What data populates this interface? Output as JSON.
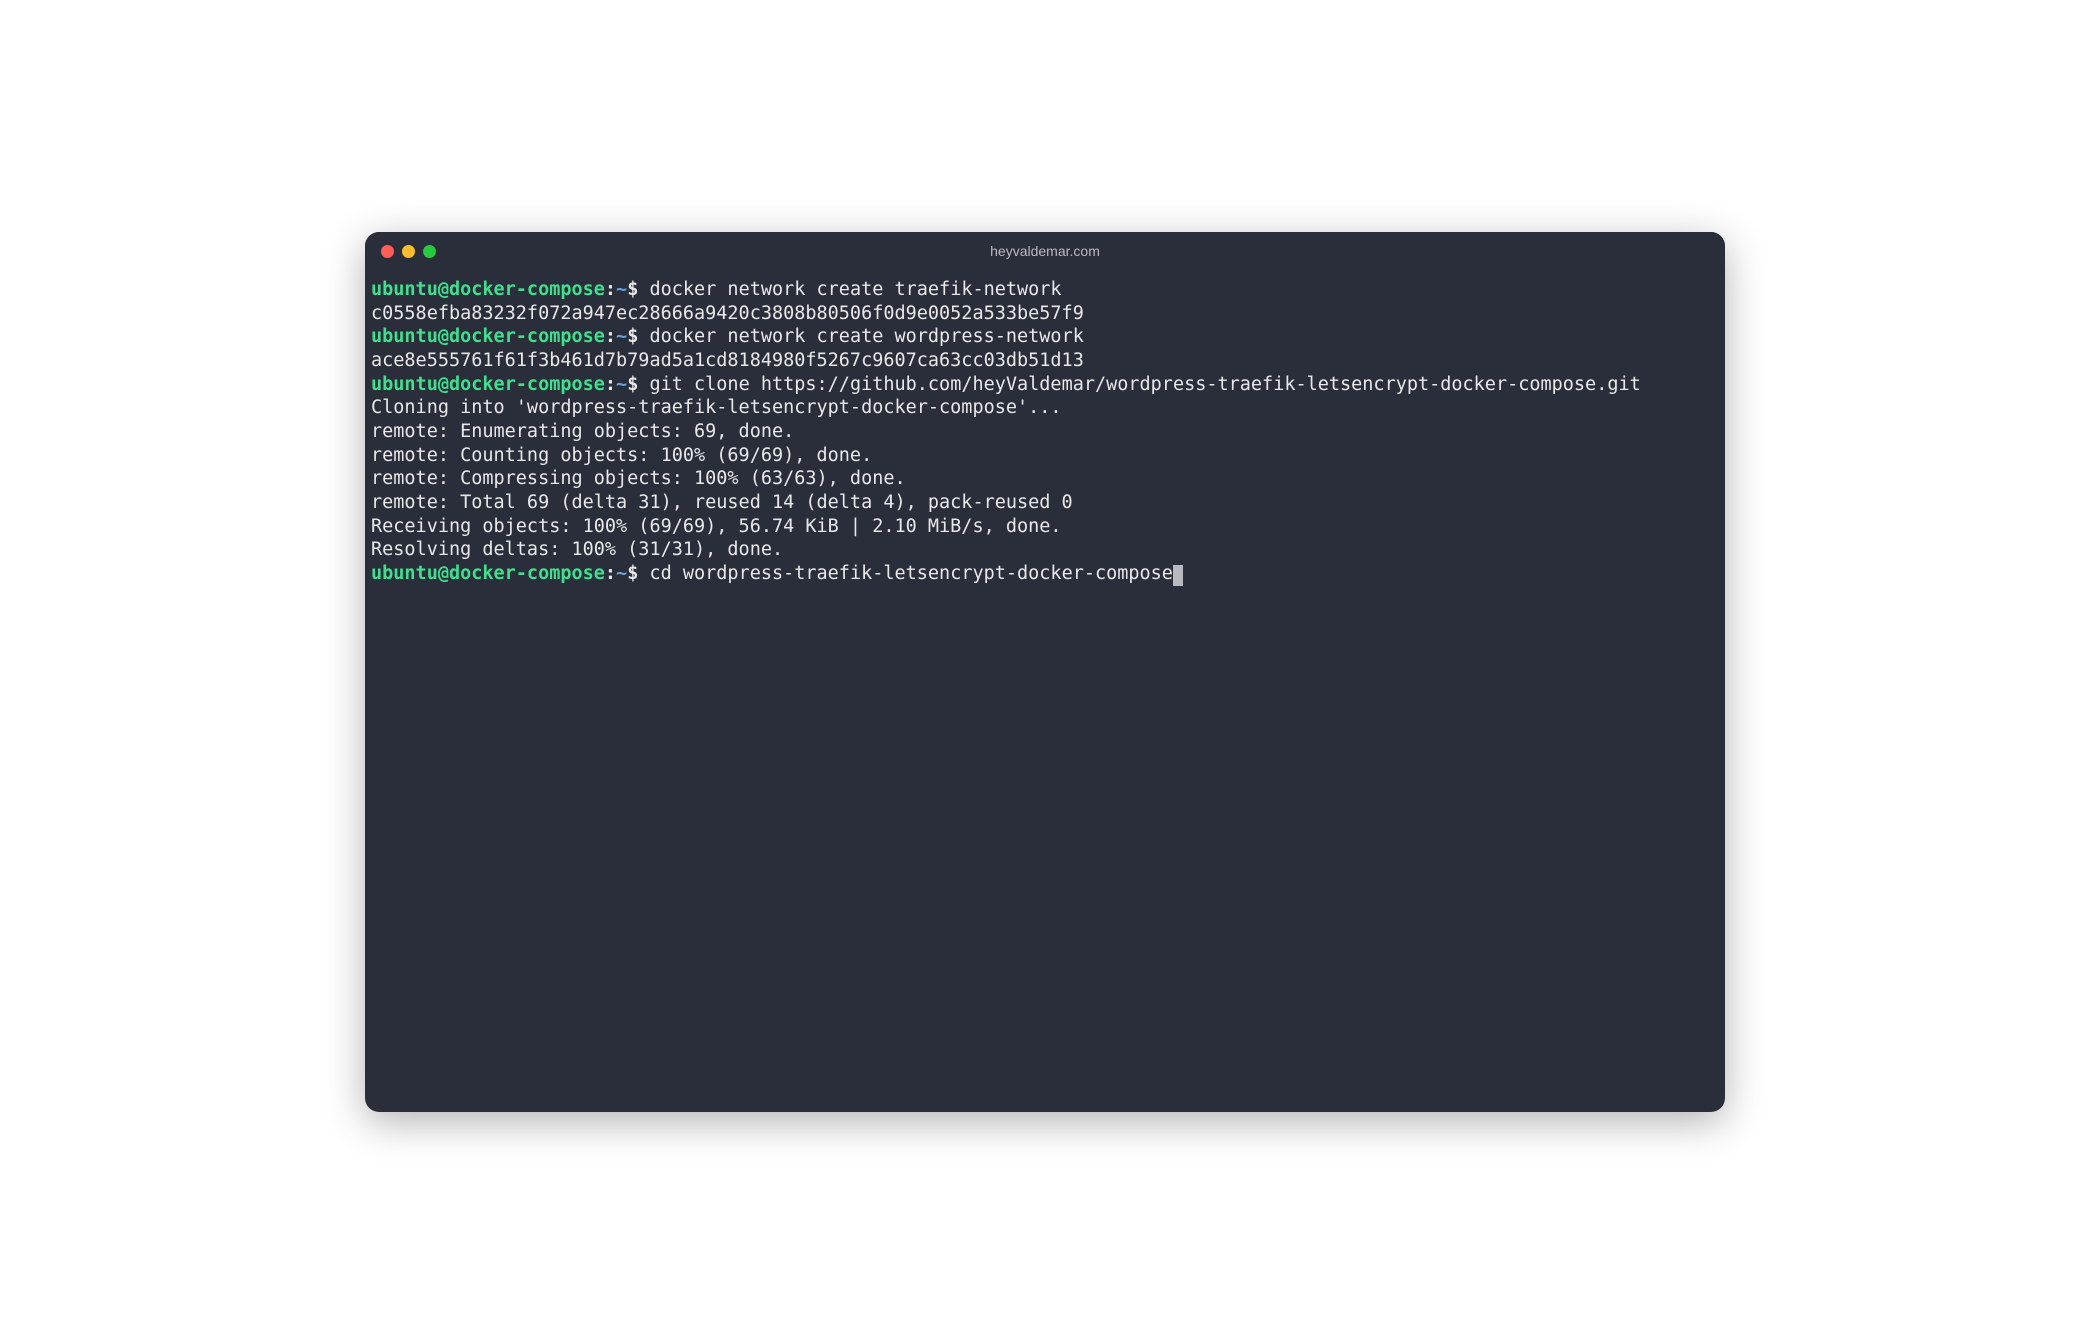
{
  "window": {
    "title": "heyvaldemar.com"
  },
  "prompt": {
    "userHost": "ubuntu@docker-compose",
    "colon": ":",
    "path": "~",
    "dollar": "$"
  },
  "lines": {
    "cmd1": " docker network create traefik-network",
    "out1": "c0558efba83232f072a947ec28666a9420c3808b80506f0d9e0052a533be57f9",
    "cmd2": " docker network create wordpress-network",
    "out2": "ace8e555761f61f3b461d7b79ad5a1cd8184980f5267c9607ca63cc03db51d13",
    "cmd3": " git clone https://github.com/heyValdemar/wordpress-traefik-letsencrypt-docker-compose.git",
    "out3": "Cloning into 'wordpress-traefik-letsencrypt-docker-compose'...",
    "out4": "remote: Enumerating objects: 69, done.",
    "out5": "remote: Counting objects: 100% (69/69), done.",
    "out6": "remote: Compressing objects: 100% (63/63), done.",
    "out7": "remote: Total 69 (delta 31), reused 14 (delta 4), pack-reused 0",
    "out8": "Receiving objects: 100% (69/69), 56.74 KiB | 2.10 MiB/s, done.",
    "out9": "Resolving deltas: 100% (31/31), done.",
    "cmd4": " cd wordpress-traefik-letsencrypt-docker-compose"
  }
}
